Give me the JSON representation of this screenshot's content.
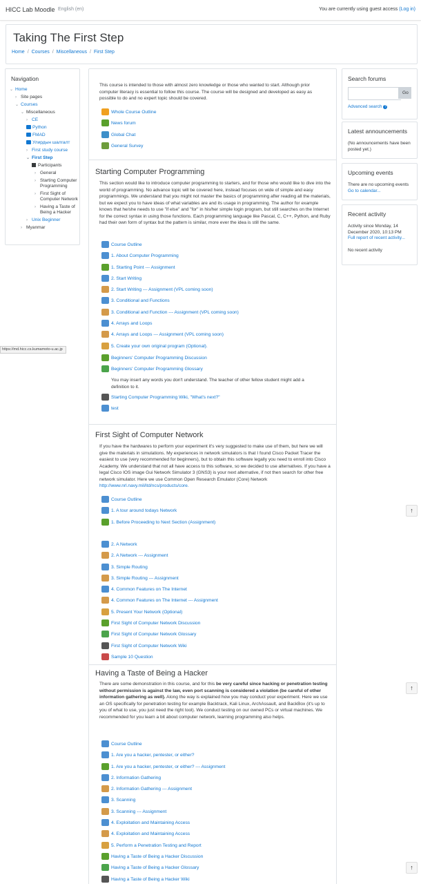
{
  "topbar": {
    "brand": "HICC Lab Moodle",
    "language": "English (en)",
    "guest_msg": "You are currently using guest access",
    "login": "(Log in)"
  },
  "header": {
    "title": "Taking The First Step",
    "breadcrumb": [
      "Home",
      "Courses",
      "Miscellaneous",
      "First Step"
    ]
  },
  "navigation": {
    "title": "Navigation",
    "items": [
      {
        "label": "Home",
        "link": true
      },
      {
        "label": "Site pages",
        "link": false
      },
      {
        "label": "Courses",
        "link": true
      },
      {
        "label": "Miscellaneous",
        "link": false
      },
      {
        "label": "CE",
        "link": true
      },
      {
        "label": "Python",
        "link": true
      },
      {
        "label": "FMAD",
        "link": true
      },
      {
        "label": "Улирдын шалгалт",
        "link": true
      },
      {
        "label": "First study course",
        "link": true
      },
      {
        "label": "First Step",
        "link": true
      },
      {
        "label": "Participants",
        "link": false
      },
      {
        "label": "General",
        "link": false
      },
      {
        "label": "Starting Computer Programming",
        "link": false
      },
      {
        "label": "First Sight of Computer Network",
        "link": false
      },
      {
        "label": "Having a Taste of Being a Hacker",
        "link": false
      },
      {
        "label": "Unix Beginner",
        "link": true
      },
      {
        "label": "Myanmar",
        "link": false
      }
    ]
  },
  "intro": {
    "text": "This course is intended to those with almost zero knowledge or those who wanted to start. Although prior computer literacy is essential to follow this course. The course will be designed and developed as easy as possible to do and no expert topic should be covered.",
    "activities": [
      {
        "label": "Whole Course Outline",
        "icon": "book-icon"
      },
      {
        "label": "News forum",
        "icon": "forum-icon"
      },
      {
        "label": "Global Chat",
        "icon": "chat-icon"
      },
      {
        "label": "General Survey",
        "icon": "survey-icon"
      }
    ]
  },
  "section1": {
    "title": "Starting Computer Programming",
    "summary": "This section would like to introduce computer programming to starters, and for those who would like to dive into the world of programming. No advance topic will be covered here, instead focuses on wide of simple and easy programmings. We understand that you might not master the basics of programming after reading all the materials, but we expect you to have ideas of what variables are and its usage in programming. The author for example knows that he/she needs to use \"if else\" and \"for\" in his/her simple login program, but still searches on the Internet for the correct syntax in using those functions. Each programming language like Pascal, C, C++, Python,  and Ruby had their own form of syntax but the pattern is similar, more ever the idea is still the same.",
    "activities": [
      {
        "label": "Course Outline",
        "icon": "page-icon"
      },
      {
        "label": "1. About Computer Programming",
        "icon": "page-icon"
      },
      {
        "label": "1. Starting Point --- Assignment",
        "icon": "forum-icon"
      },
      {
        "label": "2. Start Writing",
        "icon": "page-icon"
      },
      {
        "label": "2. Start Writing --- Assignment (VPL coming soon)",
        "icon": "assign-icon"
      },
      {
        "label": "3. Conditional and Functions",
        "icon": "page-icon"
      },
      {
        "label": "3. Conditional and Function --- Assignment (VPL coming soon)",
        "icon": "assign-icon"
      },
      {
        "label": "4. Arrays and Loops",
        "icon": "page-icon"
      },
      {
        "label": "4. Arrays and Loops --- Assignment (VPL coming soon)",
        "icon": "assign-icon"
      },
      {
        "label": "5. Create your own original program (Optional).",
        "icon": "feedback-icon"
      }
    ],
    "activities2": [
      {
        "label": "Beginners' Computer Programming Discussion",
        "icon": "forum-icon"
      },
      {
        "label": "Beginners' Computer Programming Glossary",
        "icon": "glossary-icon"
      }
    ],
    "glossary_note": "You may insert any words you don't understand. The teacher of other fellow student might add a definition to it.",
    "activities3": [
      {
        "label": "Starting Computer Programming Wiki, \"What's next?\"",
        "icon": "wiki-icon"
      },
      {
        "label": "test",
        "icon": "page-icon"
      }
    ]
  },
  "section2": {
    "title": "First Sight of Computer Network",
    "summary": "If you have the hardwares to perform your experiment it's very suggested to make use of them, but here we will give the materials in simulations. My experiences in network simulators is that I found Cisco Packet Tracer the easiest to use (very recommended for beginners), but to obtain this software legally you need to enroll into Cisco Academy. We understand that not all have access to this software, so we decided to use alternatives. If you have a legal Cisco IOS image Gui Network Simulator 3 (GNS3) is your next alternative, if not then search for other free network simulator. Here we use Common Open Research Emulator (Core) Network",
    "summary_link": "http://www.nrl.navy.mil/itd/ncs/products/core.",
    "activities": [
      {
        "label": "Course Outline",
        "icon": "page-icon"
      },
      {
        "label": "1. A tour around todays Network",
        "icon": "page-icon"
      },
      {
        "label": "1. Before Proceeding to Next Section (Assignment)",
        "icon": "forum-icon"
      }
    ],
    "activities_b": [
      {
        "label": "2. A Network",
        "icon": "page-icon"
      },
      {
        "label": "2. A Network --- Assignment",
        "icon": "assign-icon"
      },
      {
        "label": "3. Simple Routing",
        "icon": "page-icon"
      },
      {
        "label": "3. Simple Routing --- Assignment",
        "icon": "assign-icon"
      },
      {
        "label": "4. Common Features on The Internet",
        "icon": "page-icon"
      },
      {
        "label": "4. Common Features on The Internet --- Assignment",
        "icon": "assign-icon"
      },
      {
        "label": "5. Present Your Network (Optional)",
        "icon": "feedback-icon"
      },
      {
        "label": "First Sight of Computer Network Discussion",
        "icon": "forum-icon"
      },
      {
        "label": "First Sight of Computer Network Glossary",
        "icon": "glossary-icon"
      },
      {
        "label": "First Sight of Computer Network Wiki",
        "icon": "wiki-icon"
      },
      {
        "label": "Sample 10 Question",
        "icon": "quiz-icon"
      }
    ]
  },
  "section3": {
    "title": "Having a Taste of Being a Hacker",
    "summary_a": "There are some demonstration in this course, and for this ",
    "summary_bold": "be very careful since hacking or penetration testing without permission is against the law, even port scanning is considered a violation (be careful of other information gathering as well).",
    "summary_b": " Along the way is explained how you may conduct your experiment. Here we use an OS specifically for penetration testing for example Backtrack, Kali Linux, ArchAssault, and BackBox (it's up to you of what to use, you just need the right tool). We conduct testing on our owned PCs or virtual machines. We recommended for you learn a bit about computer network, learning programming also helps.",
    "activities": [
      {
        "label": "Course Outline",
        "icon": "page-icon"
      },
      {
        "label": "1. Are you a hacker, pentester, or either?",
        "icon": "page-icon"
      },
      {
        "label": "1. Are you a hacker, pentester, or either? --- Assignment",
        "icon": "forum-icon"
      },
      {
        "label": "2. Information Gathering",
        "icon": "page-icon"
      },
      {
        "label": "2. Information Gathering --- Assignment",
        "icon": "assign-icon"
      },
      {
        "label": "3. Scanning",
        "icon": "page-icon"
      },
      {
        "label": "3. Scanning --- Assignment",
        "icon": "assign-icon"
      },
      {
        "label": "4. Exploitation and Maintaining Access",
        "icon": "page-icon"
      },
      {
        "label": "4. Exploitation and Maintaining Access",
        "icon": "assign-icon"
      },
      {
        "label": "5. Perform a Penetration Testing and Report",
        "icon": "feedback-icon"
      },
      {
        "label": "Having a Taste of Being a Hacker Discussion",
        "icon": "forum-icon"
      },
      {
        "label": "Having a Taste of Being a Hacker Glossary",
        "icon": "glossary-icon"
      },
      {
        "label": "Having a Taste of Being a Hacker Wiki",
        "icon": "wiki-icon"
      }
    ]
  },
  "search_forums": {
    "title": "Search forums",
    "go": "Go",
    "advanced": "Advanced search"
  },
  "announcements": {
    "title": "Latest announcements",
    "text": "(No announcements have been posted yet.)"
  },
  "events": {
    "title": "Upcoming events",
    "text": "There are no upcoming events",
    "link": "Go to calendar..."
  },
  "recent": {
    "title": "Recent activity",
    "since": "Activity since Monday, 14 December 2020, 10:13 PM",
    "full_report": "Full report of recent activity...",
    "none": "No recent activity"
  },
  "status_url": "https://md.hicc.cs.kumamoto-u.ac.jp",
  "icons": {
    "top": "arrow-up-icon",
    "help": "question-circle-icon"
  }
}
